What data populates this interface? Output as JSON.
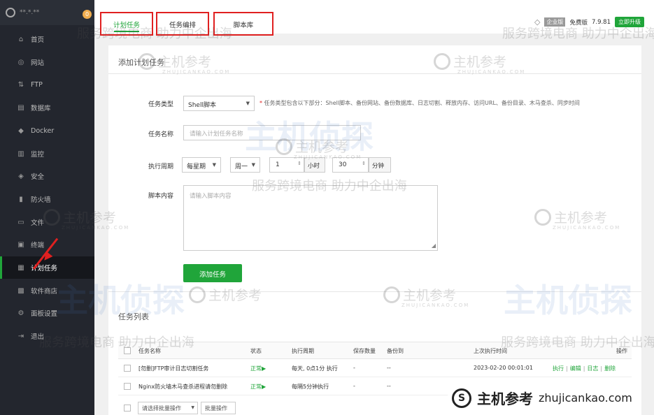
{
  "sidebar": {
    "ip": "**.*.**",
    "badge": "0",
    "items": [
      {
        "label": "首页",
        "icon": "⌂"
      },
      {
        "label": "网站",
        "icon": "◎"
      },
      {
        "label": "FTP",
        "icon": "⇅"
      },
      {
        "label": "数据库",
        "icon": "▤"
      },
      {
        "label": "Docker",
        "icon": "◆"
      },
      {
        "label": "监控",
        "icon": "▥"
      },
      {
        "label": "安全",
        "icon": "◈"
      },
      {
        "label": "防火墙",
        "icon": "▮"
      },
      {
        "label": "文件",
        "icon": "▭"
      },
      {
        "label": "终端",
        "icon": "▣"
      },
      {
        "label": "计划任务",
        "icon": "▦"
      },
      {
        "label": "软件商店",
        "icon": "▩"
      },
      {
        "label": "面板设置",
        "icon": "⚙"
      },
      {
        "label": "退出",
        "icon": "⇥"
      }
    ]
  },
  "topbar": {
    "tabs": [
      "计划任务",
      "任务编排",
      "脚本库"
    ],
    "edition_tag": "企业版",
    "edition": "免费版",
    "version": "7.9.81",
    "upgrade": "立即升级"
  },
  "form": {
    "section_title": "添加计划任务",
    "type_label": "任务类型",
    "type_value": "Shell脚本",
    "type_hint": "任务类型包含以下部分：Shell脚本、备份网站、备份数据库、日志切割、释放内存、访问URL、备份目录、木马查杀、同步时间",
    "name_label": "任务名称",
    "name_placeholder": "请输入计划任务名称",
    "cycle_label": "执行周期",
    "cycle_value": "每星期",
    "weekday_value": "周一",
    "hour_value": "1",
    "hour_unit": "小时",
    "minute_value": "30",
    "minute_unit": "分钟",
    "script_label": "脚本内容",
    "script_placeholder": "请输入脚本内容",
    "submit": "添加任务"
  },
  "table": {
    "title": "任务列表",
    "headers": [
      "任务名称",
      "状态",
      "执行周期",
      "保存数量",
      "备份到",
      "上次执行时间",
      "操作"
    ],
    "rows": [
      {
        "name": "[勿删]FTP审计日志切割任务",
        "status": "正常▶",
        "cycle": "每天, 0点1分 执行",
        "keep": "-",
        "backup": "--",
        "last": "2023-02-20 00:01:01",
        "ops": [
          "执行",
          "编辑",
          "日志",
          "删除"
        ]
      },
      {
        "name": "Nginx防火墙木马查杀进程请勿删除",
        "status": "正常▶",
        "cycle": "每隔5分钟执行",
        "keep": "-",
        "backup": "--",
        "last": "",
        "ops": []
      }
    ],
    "batch_select": "请选择批量操作",
    "batch_button": "批量操作"
  },
  "watermark": {
    "brand": "主机参考",
    "domain_caps": "ZHUJICANKAO.COM",
    "slogan": "服务跨境电商 助力中企出海",
    "big": "主机侦探",
    "footer_brand": "主机参考",
    "footer_domain": "zhujicankao.com"
  }
}
